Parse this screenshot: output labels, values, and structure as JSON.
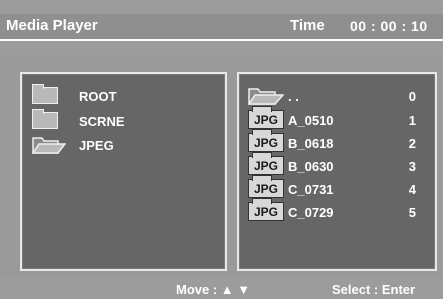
{
  "header": {
    "title": "Media Player",
    "time_label": "Time",
    "time_value": "00 : 00 : 10"
  },
  "left_panel": {
    "items": [
      {
        "label": "ROOT",
        "icon": "folder-closed-icon"
      },
      {
        "label": "SCRNE",
        "icon": "folder-closed-icon"
      },
      {
        "label": "JPEG",
        "icon": "folder-open-icon"
      }
    ]
  },
  "right_panel": {
    "items": [
      {
        "label": ". .",
        "num": "0",
        "icon": "folder-open-icon"
      },
      {
        "label": "A_0510",
        "num": "1",
        "icon": "jpg-file-icon",
        "badge": "JPG"
      },
      {
        "label": "B_0618",
        "num": "2",
        "icon": "jpg-file-icon",
        "badge": "JPG"
      },
      {
        "label": "B_0630",
        "num": "3",
        "icon": "jpg-file-icon",
        "badge": "JPG"
      },
      {
        "label": "C_0731",
        "num": "4",
        "icon": "jpg-file-icon",
        "badge": "JPG"
      },
      {
        "label": "C_0729",
        "num": "5",
        "icon": "jpg-file-icon",
        "badge": "JPG"
      }
    ]
  },
  "footer": {
    "move": "Move : ▲ ▼",
    "select": "Select : Enter"
  },
  "colors": {
    "background": "#9c9c9c",
    "panel": "#666666",
    "text": "#ffffff"
  }
}
